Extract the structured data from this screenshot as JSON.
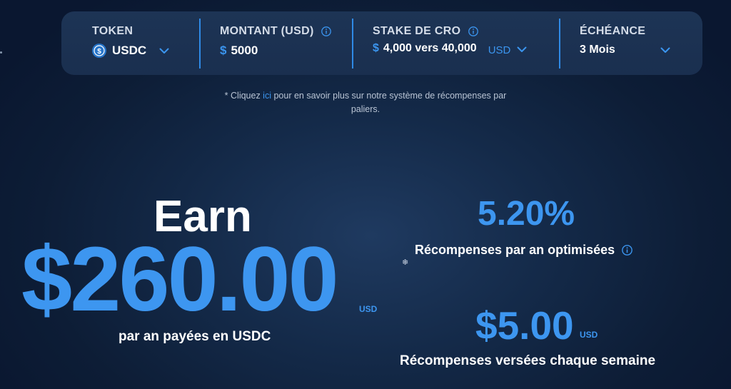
{
  "calculator": {
    "token": {
      "label": "TOKEN",
      "value": "USDC",
      "icon": "usdc-coin-icon"
    },
    "amount": {
      "label": "MONTANT (USD)",
      "currency_symbol": "$",
      "value": "5000",
      "icon": "info-icon"
    },
    "cro_stake": {
      "label": "STAKE DE CRO",
      "currency_symbol": "$",
      "value": "4,000 vers 40,000",
      "unit": "USD",
      "icon": "info-icon"
    },
    "term": {
      "label": "ÉCHÉANCE",
      "value": "3 Mois"
    }
  },
  "note": {
    "prefix": "* Cliquez ",
    "link": "ici",
    "suffix_line1": " pour en savoir plus sur notre système de récompenses par",
    "line2": "paliers."
  },
  "earnings": {
    "earn_label": "Earn",
    "amount": "$260.00",
    "currency": "USD",
    "caption": "par an payées en USDC"
  },
  "rewards": {
    "rate": "5.20%",
    "rate_caption": "Récompenses par an optimisées",
    "weekly_amount": "$5.00",
    "weekly_currency": "USD",
    "weekly_caption": "Récompenses versées chaque semaine"
  },
  "colors": {
    "accent": "#3d96f0",
    "panel": "#1d3455",
    "background": "#0d1d36"
  }
}
